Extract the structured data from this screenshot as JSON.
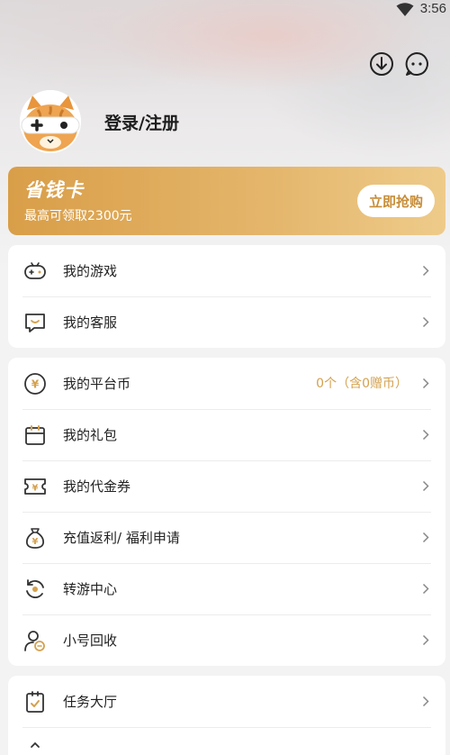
{
  "status_bar": {
    "time": "3:56",
    "wifi_icon": "wifi-icon"
  },
  "header": {
    "download_icon": "download-icon",
    "message_icon": "message-icon",
    "avatar_icon": "cat-gamepad-avatar",
    "login_label": "登录/注册"
  },
  "promo_card": {
    "title": "省钱卡",
    "subtitle": "最高可领取2300元",
    "button_label": "立即抢购"
  },
  "group1": {
    "items": [
      {
        "label": "我的游戏",
        "icon": "gamepad-icon"
      },
      {
        "label": "我的客服",
        "icon": "customer-service-icon"
      }
    ]
  },
  "group2": {
    "items": [
      {
        "label": "我的平台币",
        "icon": "coin-icon",
        "value": "0个（含0赠币）"
      },
      {
        "label": "我的礼包",
        "icon": "gift-icon"
      },
      {
        "label": "我的代金券",
        "icon": "voucher-icon"
      },
      {
        "label": "充值返利/ 福利申请",
        "icon": "money-bag-icon"
      },
      {
        "label": "转游中心",
        "icon": "transfer-icon"
      },
      {
        "label": "小号回收",
        "icon": "account-recycle-icon"
      }
    ]
  },
  "group3": {
    "items": [
      {
        "label": "任务大厅",
        "icon": "task-clipboard-icon"
      }
    ]
  },
  "colors": {
    "accent": "#d4a14f",
    "card_gradient_start": "#d99e48",
    "card_gradient_end": "#eecb8a",
    "icon_stroke": "#333333"
  }
}
